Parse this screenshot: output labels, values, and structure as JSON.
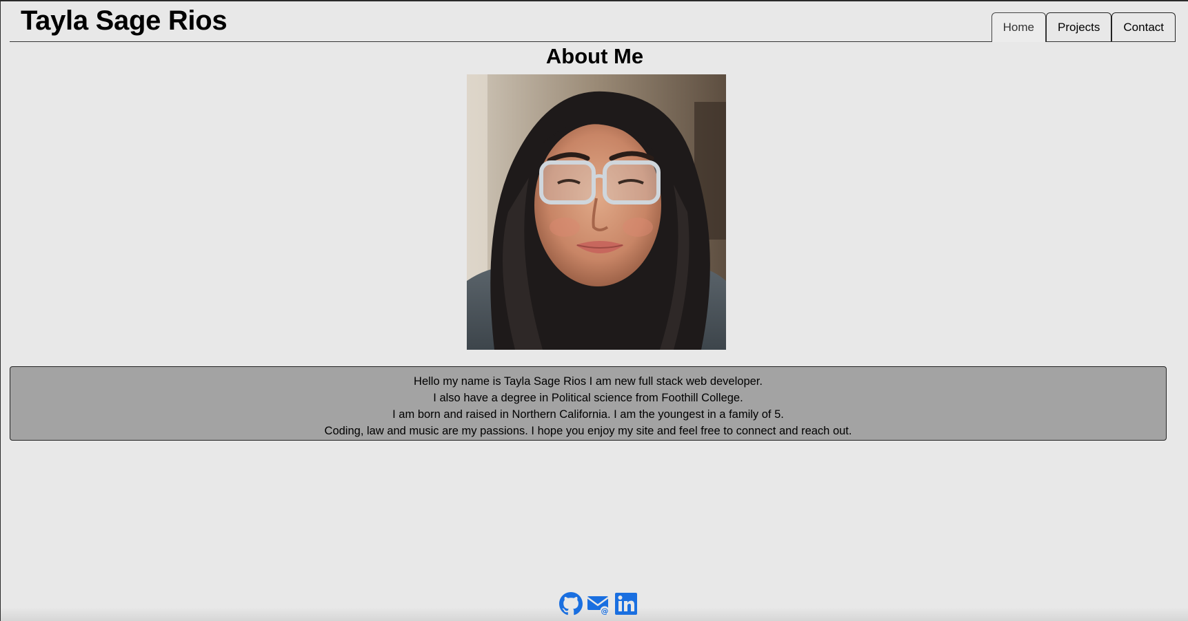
{
  "header": {
    "site_title": "Tayla Sage Rios"
  },
  "nav": {
    "tabs": [
      {
        "label": "Home",
        "active": true
      },
      {
        "label": "Projects",
        "active": false
      },
      {
        "label": "Contact",
        "active": false
      }
    ]
  },
  "main": {
    "heading": "About Me",
    "bio_lines": [
      "Hello my name is Tayla Sage Rios I am new full stack web developer.",
      "I also have a degree in Political science from Foothill College.",
      "I am born and raised in Northern California. I am the youngest in a family of 5.",
      "Coding, law and music are my passions. I hope you enjoy my site and feel free to connect and reach out."
    ]
  },
  "footer": {
    "icons": [
      "github-icon",
      "email-icon",
      "linkedin-icon"
    ]
  },
  "colors": {
    "background": "#e8e8e8",
    "bio_box": "#a3a3a3",
    "icon_blue": "#1a6fe0"
  }
}
